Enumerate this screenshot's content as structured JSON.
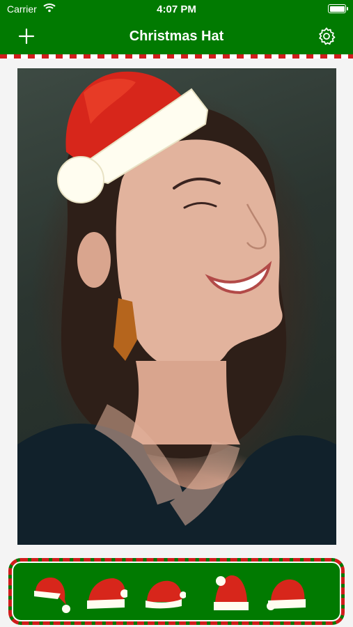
{
  "status_bar": {
    "carrier": "Carrier",
    "time": "4:07 PM"
  },
  "nav": {
    "title": "Christmas Hat",
    "left_icon": "plus-icon",
    "right_icon": "gear-icon"
  },
  "colors": {
    "nav_background": "#017a01",
    "stripe_red": "#d11c1c",
    "hat_red": "#d7261b",
    "fur_white": "#fffdf0"
  },
  "photo": {
    "description_icon": "photo-with-hat"
  },
  "hat_strip": {
    "items": [
      {
        "icon": "santa-hat-1-icon"
      },
      {
        "icon": "santa-hat-2-icon"
      },
      {
        "icon": "santa-hat-3-icon"
      },
      {
        "icon": "santa-hat-4-icon"
      },
      {
        "icon": "santa-hat-5-icon"
      }
    ]
  }
}
